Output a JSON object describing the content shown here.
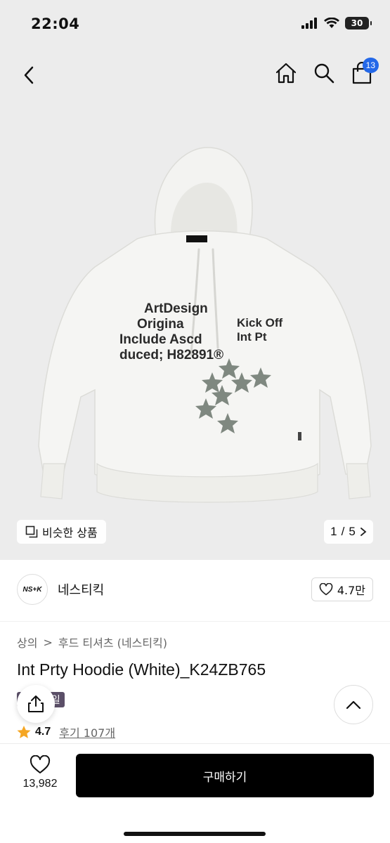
{
  "status_bar": {
    "time": "22:04",
    "battery": "30"
  },
  "header": {
    "cart_count": "13"
  },
  "gallery": {
    "similar_label": "비슷한 상품",
    "current": "1",
    "separator": "/",
    "total": "5",
    "print_text": [
      "ArtDesign",
      "Origina",
      "Include Ascd",
      "duced; H82891®"
    ],
    "print_text_right": [
      "Kick Off",
      "Int Pt"
    ]
  },
  "brand": {
    "logo_text": "NS+K",
    "name": "네스티킥",
    "likes": "4.7만"
  },
  "breadcrumb": {
    "items": [
      "상의",
      "후드 티셔츠 (네스티킥)"
    ],
    "sep": ">"
  },
  "product": {
    "title": "Int Prty Hoodie (White)_K24ZB765",
    "badge": "세일"
  },
  "rating": {
    "score": "4.7",
    "reviews": "후기 107개"
  },
  "bottom": {
    "wish_count": "13,982",
    "buy_label": "구매하기"
  },
  "colors": {
    "badge": "#5b4f68",
    "cart_badge": "#2468e8",
    "star": "#f5a623"
  }
}
